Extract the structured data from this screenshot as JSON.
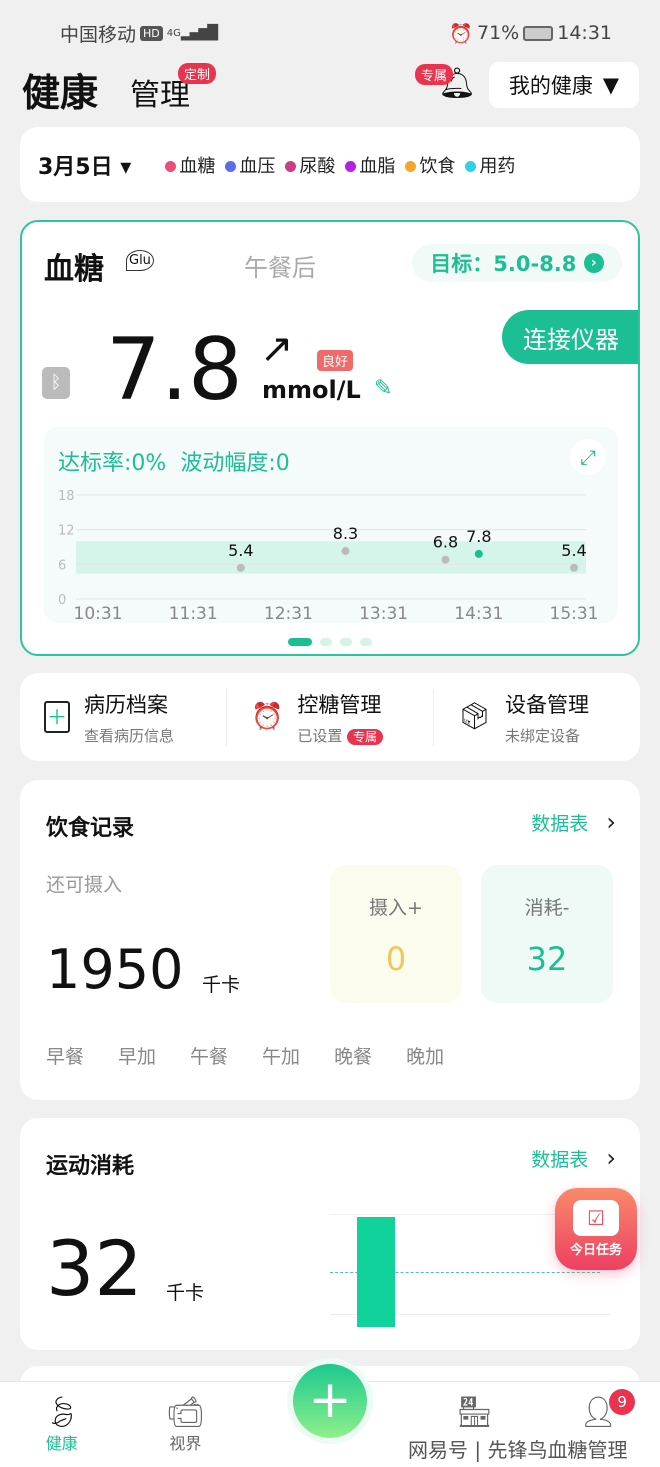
{
  "status": {
    "carrier": "中国移动",
    "hd": "HD",
    "net": "4G",
    "alarm": "⏰",
    "battery": "71%",
    "time": "14:31"
  },
  "header": {
    "title": "健康",
    "tab2": "管理",
    "tab2_badge": "定制",
    "bell_badge": "专属",
    "selector": "我的健康"
  },
  "filter": {
    "date": "3月5日",
    "legend": [
      {
        "label": "血糖",
        "color": "#ee4d7a"
      },
      {
        "label": "血压",
        "color": "#5b6cf0"
      },
      {
        "label": "尿酸",
        "color": "#cc3d8b"
      },
      {
        "label": "血脂",
        "color": "#b620e0"
      },
      {
        "label": "饮食",
        "color": "#f5a623"
      },
      {
        "label": "用药",
        "color": "#2fd0e8"
      }
    ]
  },
  "glucose": {
    "title": "血糖",
    "glu": "Glu",
    "period": "午餐后",
    "target": "目标：5.0-8.8",
    "connect": "连接仪器",
    "value": "7.8",
    "unit": "mmol/L",
    "trend": "↗",
    "status": "良好",
    "rate": "达标率:0%",
    "fluct": "波动幅度:0",
    "page_dots": 4,
    "active_dot": 0
  },
  "chart_data": {
    "type": "scatter",
    "ylim": [
      0,
      18
    ],
    "yticks": [
      "0",
      "6",
      "12",
      "18"
    ],
    "xticks": [
      "10:31",
      "11:31",
      "12:31",
      "13:31",
      "14:31",
      "15:31"
    ],
    "target_band": [
      4.4,
      10
    ],
    "points": [
      {
        "x": "12:01",
        "y": 5.4,
        "label": "5.4"
      },
      {
        "x": "13:07",
        "y": 8.3,
        "label": "8.3"
      },
      {
        "x": "14:10",
        "y": 6.8,
        "label": "6.8"
      },
      {
        "x": "14:31",
        "y": 7.8,
        "label": "7.8",
        "current": true
      },
      {
        "x": "15:31",
        "y": 5.4,
        "label": "5.4"
      }
    ]
  },
  "quick": [
    {
      "title": "病历档案",
      "sub": "查看病历信息",
      "icon": "medical-record-icon"
    },
    {
      "title": "控糖管理",
      "sub": "已设置",
      "badge": "专属",
      "icon": "alarm-clock-icon"
    },
    {
      "title": "设备管理",
      "sub": "未绑定设备",
      "icon": "device-box-icon"
    }
  ],
  "diet": {
    "title": "饮食记录",
    "table": "数据表",
    "remain_label": "还可摄入",
    "remain": "1950",
    "unit": "千卡",
    "intake_label": "摄入+",
    "intake": "0",
    "burn_label": "消耗-",
    "burn": "32",
    "meals": [
      "早餐",
      "早加",
      "午餐",
      "午加",
      "晚餐",
      "晚加"
    ]
  },
  "exercise": {
    "title": "运动消耗",
    "table": "数据表",
    "value": "32",
    "unit": "千卡"
  },
  "task": {
    "label": "今日任务"
  },
  "nav": [
    {
      "label": "健康",
      "active": true
    },
    {
      "label": "视界"
    },
    {
      "label": "商城"
    },
    {
      "label": "我的",
      "badge": "9"
    }
  ],
  "watermark": "网易号 | 先锋鸟血糖管理"
}
